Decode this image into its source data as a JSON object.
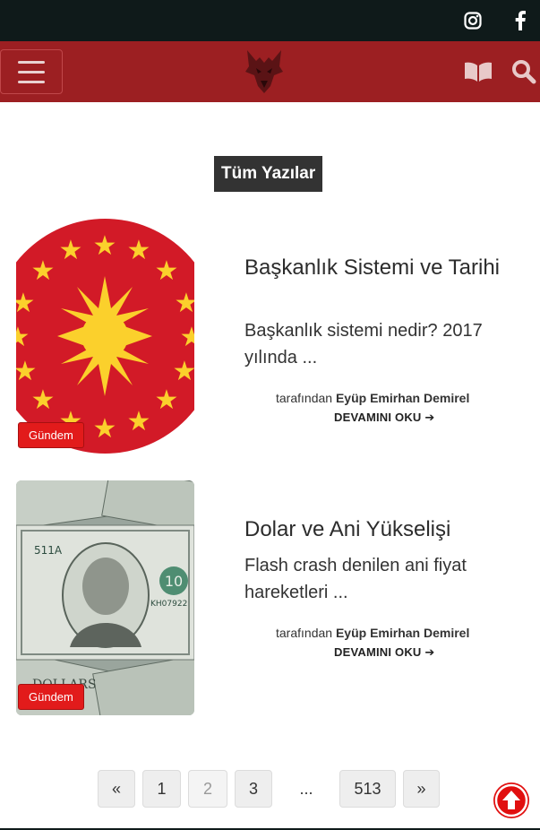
{
  "header": {
    "social_icons": [
      "instagram-icon",
      "facebook-icon"
    ],
    "nav_icons": [
      "menu-icon",
      "logo",
      "book-icon",
      "search-icon"
    ]
  },
  "section": {
    "title": "Tüm Yazılar"
  },
  "posts": [
    {
      "title": "Başkanlık Sistemi ve Tarihi",
      "excerpt": "Başkanlık sistemi nedir? 2017 yılında ...",
      "category": "Gündem",
      "author_prefix": "tarafından",
      "author": "Eyüp Emirhan Demirel",
      "read_more": "DEVAMINI OKU"
    },
    {
      "title": "Dolar ve Ani Yükselişi",
      "excerpt": "Flash crash denilen ani fiyat hareketleri ...",
      "category": "Gündem",
      "author_prefix": "tarafından",
      "author": "Eyüp Emirhan Demirel",
      "read_more": "DEVAMINI OKU"
    }
  ],
  "pagination": {
    "prev": "«",
    "pages": [
      "1",
      "2",
      "3"
    ],
    "current": "2",
    "ellipsis": "...",
    "last": "513",
    "next": "»"
  },
  "colors": {
    "topbar": "#0f1a1a",
    "navbar": "#9c1f22",
    "badge": "#e21b1b",
    "to_top": "#e10f0f"
  }
}
